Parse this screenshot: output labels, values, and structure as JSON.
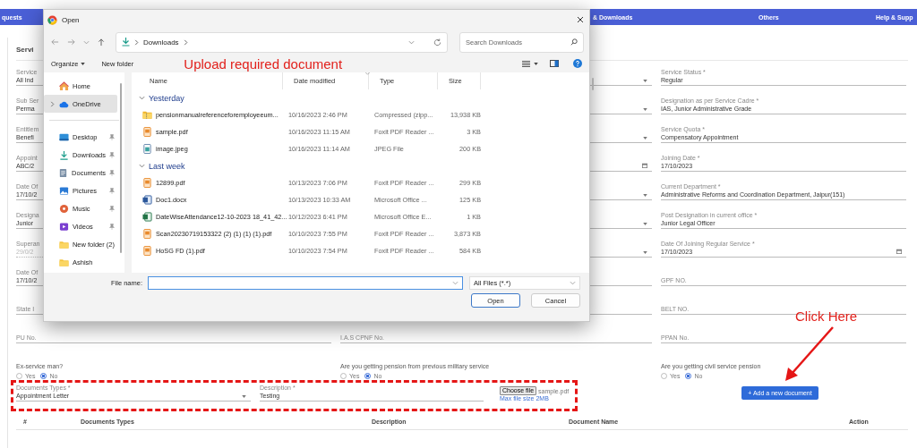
{
  "nav": {
    "items": [
      "quests",
      "& Downloads",
      "Others",
      "Help & Supp"
    ]
  },
  "section_title": "Servi",
  "form_rows": [
    [
      {
        "kind": "text",
        "label": "Service",
        "value": "All Ind",
        "disabled": false
      },
      {
        "kind": "select",
        "disabled": false
      },
      {
        "kind": "text",
        "label": "Service Status *",
        "value": "Regular",
        "disabled": false
      }
    ],
    [
      {
        "kind": "text",
        "label": "Sub Ser",
        "value": "Perma",
        "disabled": false
      },
      {
        "kind": "select",
        "disabled": false
      },
      {
        "kind": "text",
        "label": "Designation as per Service Cadre *",
        "value": "IAS, Junior Administrative Grade",
        "disabled": false
      }
    ],
    [
      {
        "kind": "text",
        "label": "Entitlem",
        "value": "Benefi",
        "disabled": false
      },
      {
        "kind": "select",
        "disabled": false
      },
      {
        "kind": "text",
        "label": "Service Quota *",
        "value": "Compensatory Appointment",
        "disabled": false
      }
    ],
    [
      {
        "kind": "text",
        "label": "Appoint",
        "value": "ABC/2",
        "disabled": false
      },
      {
        "kind": "date",
        "disabled": false
      },
      {
        "kind": "text",
        "label": "Joining Date *",
        "value": "17/10/2023",
        "disabled": false
      }
    ],
    [
      {
        "kind": "text",
        "label": "Date Of",
        "value": "17/10/2",
        "disabled": false
      },
      {
        "kind": "select",
        "disabled": false
      },
      {
        "kind": "text",
        "label": "Current Department *",
        "value": "Administrative Reforms and Coordination Department, Jaipur(151)",
        "disabled": false
      }
    ],
    [
      {
        "kind": "text",
        "label": "Designa",
        "value": "Junior",
        "disabled": false
      },
      {
        "kind": "select",
        "disabled": false
      },
      {
        "kind": "text",
        "label": "Post Designation in current office *",
        "value": "Junior Legal Officer",
        "disabled": false
      }
    ],
    [
      {
        "kind": "text",
        "label": "Superan",
        "value": "29/0/2",
        "disabled": true
      },
      {
        "kind": "select",
        "disabled": false
      },
      {
        "kind": "date",
        "label": "Date Of Joining Regular Service *",
        "value": "17/10/2023",
        "disabled": false
      }
    ],
    [
      {
        "kind": "text",
        "label": "Date Of",
        "value": "17/10/2",
        "disabled": false
      },
      {
        "kind": "text",
        "disabled": false
      },
      {
        "kind": "text",
        "placeholder": "GPF NO.",
        "disabled": false
      }
    ],
    [
      {
        "kind": "text",
        "placeholder": "State I",
        "disabled": false
      },
      {
        "kind": "text",
        "disabled": false
      },
      {
        "kind": "text",
        "placeholder": "BELT NO.",
        "disabled": false
      }
    ],
    [
      {
        "kind": "text",
        "placeholder": "PU No.",
        "disabled": false
      },
      {
        "kind": "text",
        "placeholder": "I.A.S CPNF No.",
        "disabled": false
      },
      {
        "kind": "text",
        "placeholder": "PPAN No.",
        "disabled": false
      }
    ]
  ],
  "questions": [
    {
      "label": "Ex-service man?",
      "options": [
        {
          "label": "Yes",
          "selected": false
        },
        {
          "label": "No",
          "selected": true
        }
      ]
    },
    {
      "label": "Are you getting pension from previous military service",
      "options": [
        {
          "label": "Yes",
          "selected": false
        },
        {
          "label": "No",
          "selected": true
        }
      ]
    },
    {
      "label": "Are you getting civil service pension",
      "options": [
        {
          "label": "Yes",
          "selected": false
        },
        {
          "label": "No",
          "selected": true
        }
      ]
    }
  ],
  "document_form": {
    "type_label": "Documents Types *",
    "type_value": "Appointment Letter",
    "description_label": "Description *",
    "description_value": "Testing",
    "file_button": "Choose file",
    "file_name": "sample.pdf",
    "file_hint": "Max file size 2MB",
    "add_button": "+ Add a new document"
  },
  "table": {
    "columns": [
      "#",
      "Documents Types",
      "Description",
      "Document Name",
      "Action"
    ]
  },
  "annotations": {
    "dialog_caption": "Upload required document",
    "callout": "Click Here"
  },
  "dialog": {
    "title": "Open",
    "path": [
      "Downloads"
    ],
    "search_placeholder": "Search Downloads",
    "toolbar": [
      "Organize",
      "New folder"
    ],
    "nav_pane": [
      {
        "items": [
          {
            "label": "Home",
            "kind": "home",
            "selected": false,
            "pinned": false,
            "expandable": false
          },
          {
            "label": "OneDrive",
            "kind": "cloud",
            "selected": true,
            "pinned": false,
            "expandable": true
          }
        ]
      },
      {
        "items": [
          {
            "label": "Desktop",
            "kind": "desktop",
            "selected": false,
            "pinned": true,
            "expandable": false
          },
          {
            "label": "Downloads",
            "kind": "downloads",
            "selected": false,
            "pinned": true,
            "expandable": false
          },
          {
            "label": "Documents",
            "kind": "documents",
            "selected": false,
            "pinned": true,
            "expandable": false
          },
          {
            "label": "Pictures",
            "kind": "pictures",
            "selected": false,
            "pinned": true,
            "expandable": false
          },
          {
            "label": "Music",
            "kind": "music",
            "selected": false,
            "pinned": true,
            "expandable": false
          },
          {
            "label": "Videos",
            "kind": "videos",
            "selected": false,
            "pinned": true,
            "expandable": false
          },
          {
            "label": "New folder (2)",
            "kind": "folder",
            "selected": false,
            "pinned": false,
            "expandable": false
          },
          {
            "label": "Ashish",
            "kind": "folder",
            "selected": false,
            "pinned": false,
            "expandable": false
          }
        ]
      }
    ],
    "columns": [
      "Name",
      "Date modified",
      "Type",
      "Size"
    ],
    "groups": [
      {
        "label": "Yesterday",
        "expanded": true,
        "files": [
          {
            "name": "pensionmanualreferenceforemployeeum...",
            "date": "10/16/2023 2:46 PM",
            "type": "Compressed (zipp...",
            "size": "13,938 KB",
            "kind": "zip"
          },
          {
            "name": "sample.pdf",
            "date": "10/16/2023 11:15 AM",
            "type": "Foxit PDF Reader ...",
            "size": "3 KB",
            "kind": "pdf"
          },
          {
            "name": "image.jpeg",
            "date": "10/16/2023 11:14 AM",
            "type": "JPEG File",
            "size": "200 KB",
            "kind": "image"
          }
        ]
      },
      {
        "label": "Last week",
        "expanded": true,
        "files": [
          {
            "name": "12899.pdf",
            "date": "10/13/2023 7:06 PM",
            "type": "Foxit PDF Reader ...",
            "size": "299 KB",
            "kind": "pdf"
          },
          {
            "name": "Doc1.docx",
            "date": "10/13/2023 10:33 AM",
            "type": "Microsoft Office ...",
            "size": "125 KB",
            "kind": "word"
          },
          {
            "name": "DateWiseAttendance12-10-2023 18_41_42...",
            "date": "10/12/2023 6:41 PM",
            "type": "Microsoft Office E...",
            "size": "1 KB",
            "kind": "excel"
          },
          {
            "name": "Scan20230719153322 (2) (1) (1) (1).pdf",
            "date": "10/10/2023 7:55 PM",
            "type": "Foxit PDF Reader ...",
            "size": "3,873 KB",
            "kind": "pdf"
          },
          {
            "name": "HoSG FD (1).pdf",
            "date": "10/10/2023 7:54 PM",
            "type": "Foxit PDF Reader ...",
            "size": "584 KB",
            "kind": "pdf"
          }
        ]
      }
    ],
    "file_name_label": "File name:",
    "file_name_focused": true,
    "filter": "All Files (*.*)",
    "buttons": [
      {
        "label": "Open",
        "default": true
      },
      {
        "label": "Cancel",
        "default": false
      }
    ]
  }
}
